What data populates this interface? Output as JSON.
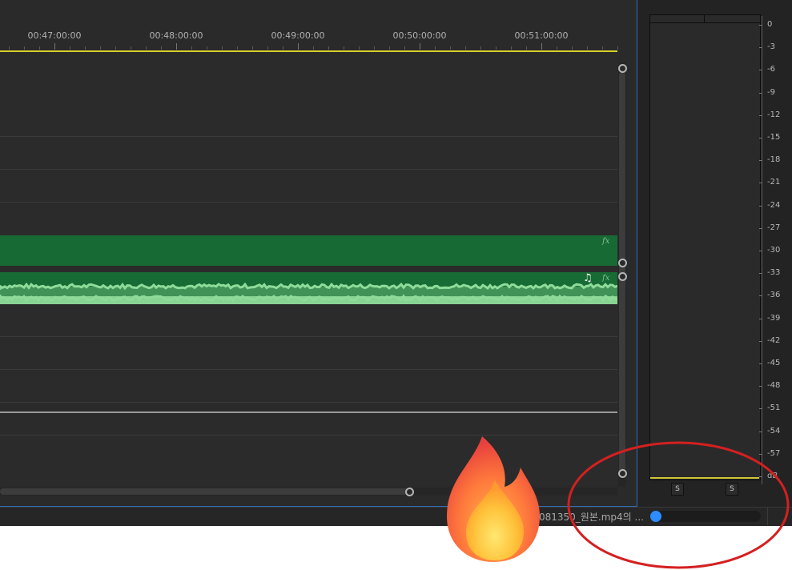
{
  "ruler": {
    "timecodes": [
      "00:47:00:00",
      "00:48:00:00",
      "00:49:00:00",
      "00:50:00:00",
      "00:51:00:00"
    ]
  },
  "tracks": {
    "video_clip": {
      "fx_label": "fx",
      "color": "#186a35"
    },
    "audio_clip": {
      "fx_label": "fx",
      "note_symbol": "♫",
      "color": "#176b34",
      "waveform_color": "#8fdc9a"
    }
  },
  "meter": {
    "scale": [
      "0",
      "-3",
      "-6",
      "-9",
      "-12",
      "-15",
      "-18",
      "-21",
      "-24",
      "-27",
      "-30",
      "-33",
      "-36",
      "-39",
      "-42",
      "-45",
      "-48",
      "-51",
      "-54",
      "-57",
      "dB"
    ],
    "solo_left": "S",
    "solo_right": "S"
  },
  "status": {
    "file_label": "081350_원본.mp4의 ...",
    "progress": 0.1
  },
  "overlay": {
    "icon": "fire-emoji-icon",
    "annotation_color": "#d42020"
  },
  "colors": {
    "playhead": "#d8d12c",
    "selection_border": "#2f6fb5",
    "progress": "#2d8cff"
  }
}
